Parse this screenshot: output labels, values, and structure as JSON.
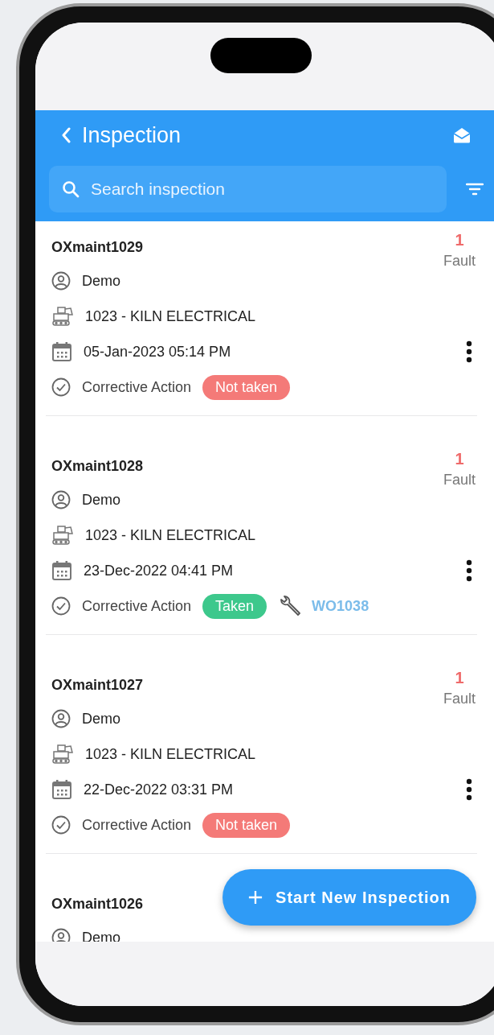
{
  "header": {
    "title": "Inspection"
  },
  "search": {
    "placeholder": "Search inspection"
  },
  "inspections": [
    {
      "id": "OXmaint1029",
      "fault_count": "1",
      "fault_label": "Fault",
      "user": "Demo",
      "asset": "1023 - KILN ELECTRICAL",
      "date": "05-Jan-2023 05:14 PM",
      "action_label": "Corrective Action",
      "status": {
        "label": "Not taken",
        "taken": false
      }
    },
    {
      "id": "OXmaint1028",
      "fault_count": "1",
      "fault_label": "Fault",
      "user": "Demo",
      "asset": "1023 - KILN ELECTRICAL",
      "date": "23-Dec-2022 04:41 PM",
      "action_label": "Corrective Action",
      "status": {
        "label": "Taken",
        "taken": true
      },
      "work_order": "WO1038"
    },
    {
      "id": "OXmaint1027",
      "fault_count": "1",
      "fault_label": "Fault",
      "user": "Demo",
      "asset": "1023 - KILN ELECTRICAL",
      "date": "22-Dec-2022 03:31 PM",
      "action_label": "Corrective Action",
      "status": {
        "label": "Not taken",
        "taken": false
      }
    },
    {
      "id": "OXmaint1026",
      "user": "Demo"
    }
  ],
  "fab": {
    "label": "Start New Inspection"
  }
}
